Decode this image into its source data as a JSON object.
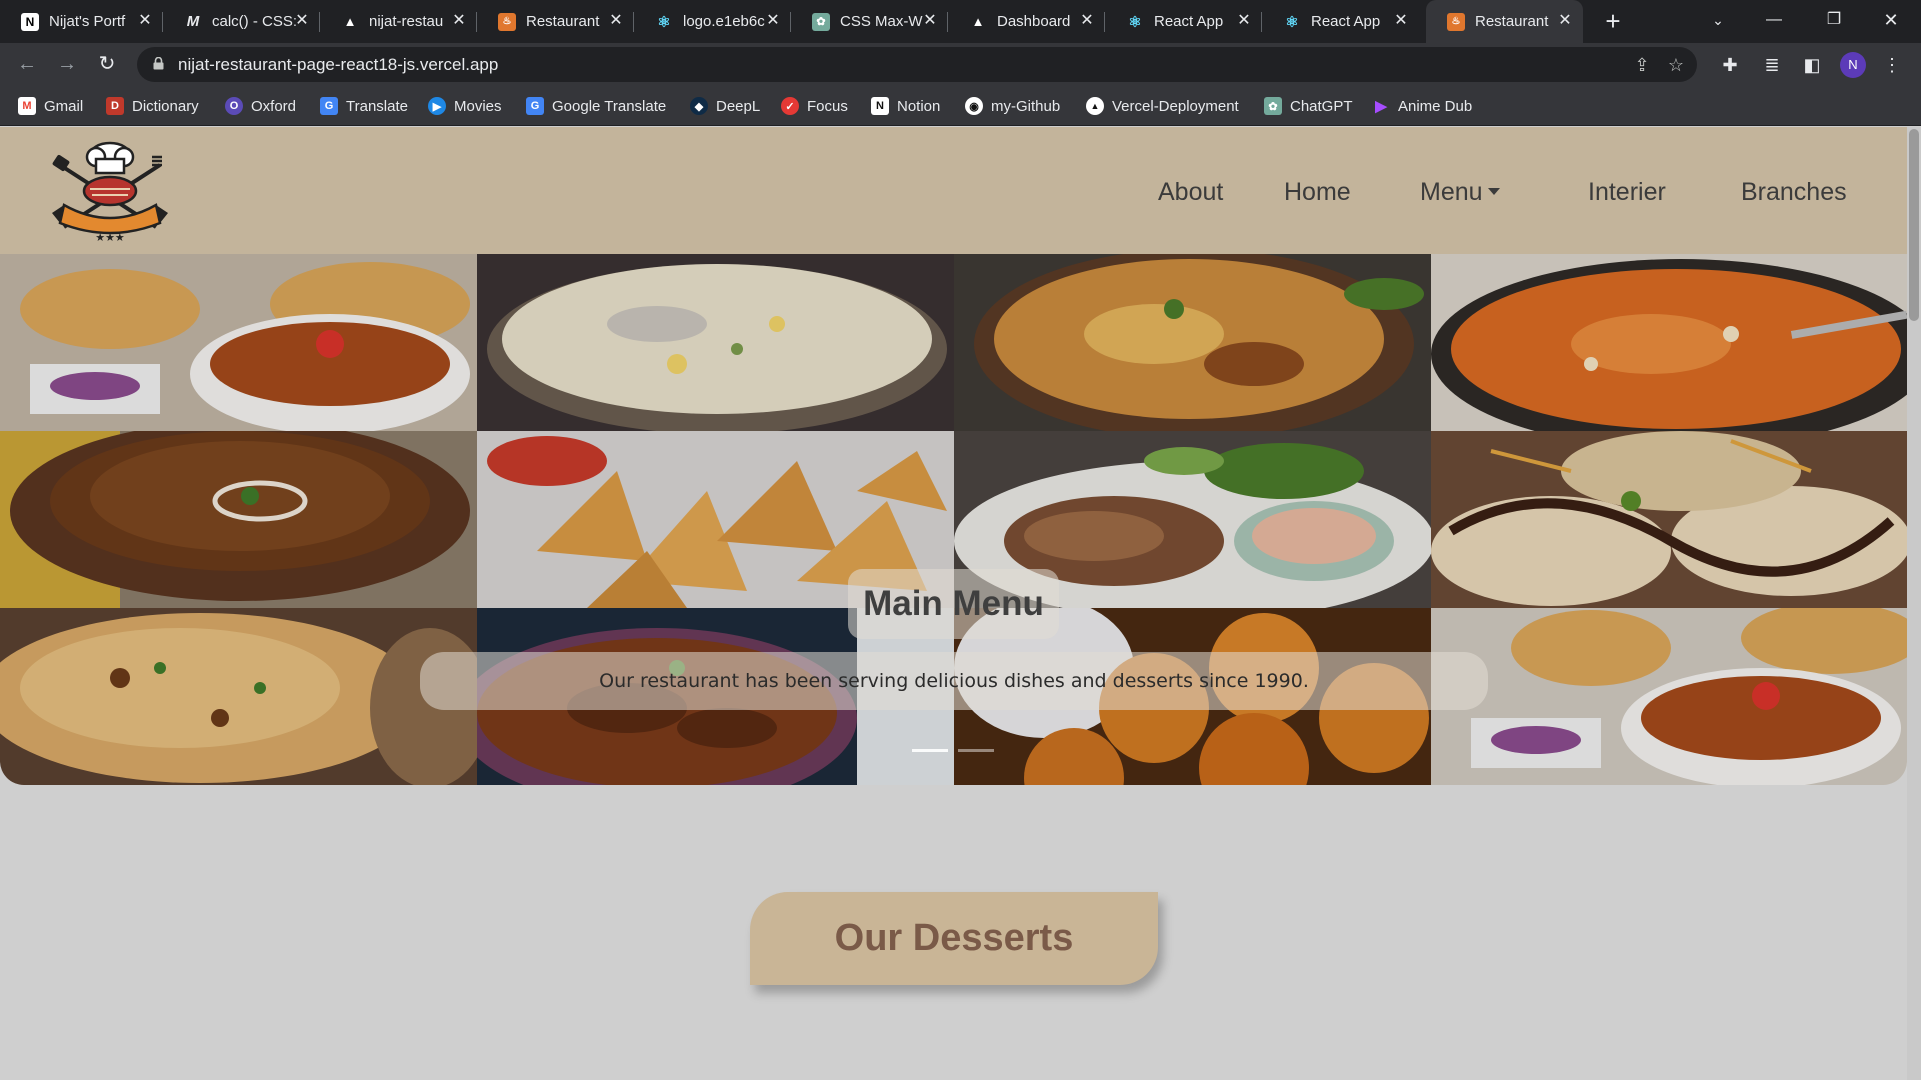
{
  "browser": {
    "tabs": [
      {
        "title": "Nijat's Portf",
        "icon": "notion-n-icon",
        "active": false
      },
      {
        "title": "calc() - CSS:",
        "icon": "mdn-m-icon",
        "active": false
      },
      {
        "title": "nijat-restau",
        "icon": "vercel-triangle-icon",
        "active": false
      },
      {
        "title": "Restaurant",
        "icon": "chef-icon",
        "active": false
      },
      {
        "title": "logo.e1eb6c",
        "icon": "react-icon",
        "active": false
      },
      {
        "title": "CSS Max-W",
        "icon": "chatgpt-icon",
        "active": false
      },
      {
        "title": "Dashboard",
        "icon": "vercel-triangle-icon",
        "active": false
      },
      {
        "title": "React App",
        "icon": "react-icon",
        "active": false
      },
      {
        "title": "React App",
        "icon": "react-icon",
        "active": false
      },
      {
        "title": "Restaurant",
        "icon": "chef-icon",
        "active": true
      }
    ],
    "url": "nijat-restaurant-page-react18-js.vercel.app",
    "profile_initial": "N",
    "bookmarks": [
      {
        "label": "Gmail",
        "icon": "gmail-icon",
        "color": "#ea4335"
      },
      {
        "label": "Dictionary",
        "icon": "dictionary-icon",
        "color": "#c0392b"
      },
      {
        "label": "Oxford",
        "icon": "oxford-icon",
        "color": "#5b4bb7"
      },
      {
        "label": "Translate",
        "icon": "translate-icon",
        "color": "#4285f4"
      },
      {
        "label": "Movies",
        "icon": "movies-icon",
        "color": "#1e88e5"
      },
      {
        "label": "Google Translate",
        "icon": "google-translate-icon",
        "color": "#4285f4"
      },
      {
        "label": "DeepL",
        "icon": "deepl-icon",
        "color": "#0f2b46"
      },
      {
        "label": "Focus",
        "icon": "focus-icon",
        "color": "#e53935"
      },
      {
        "label": "Notion",
        "icon": "notion-icon",
        "color": "#111111"
      },
      {
        "label": "my-Github",
        "icon": "github-icon",
        "color": "#111111"
      },
      {
        "label": "Vercel-Deployment",
        "icon": "vercel-icon",
        "color": "#111111"
      },
      {
        "label": "ChatGPT",
        "icon": "chatgpt-icon",
        "color": "#74aa9c"
      },
      {
        "label": "Anime Dub",
        "icon": "anime-dub-icon",
        "color": "#8e24aa"
      }
    ]
  },
  "site": {
    "nav": {
      "about": "About",
      "home": "Home",
      "menu": "Menu",
      "interier": "Interier",
      "branches": "Branches"
    },
    "hero": {
      "title": "Main Menu",
      "text": "Our restaurant has been serving delicious dishes and desserts since 1990.",
      "tiles": [
        "chole-bhature",
        "kheer",
        "biryani",
        "butter-chicken",
        "dal-makhani",
        "samosa",
        "grilled-chicken",
        "dahi-puri",
        "naan",
        "mutton-curry",
        "raita-gulab-jamun",
        "chole-bhature"
      ]
    },
    "section_title": "Our Desserts",
    "colors": {
      "navbar": "#c3b49b",
      "accent": "#c9b596",
      "dessert_text": "#7a5a48",
      "page_bg": "#cfcfcf"
    }
  }
}
